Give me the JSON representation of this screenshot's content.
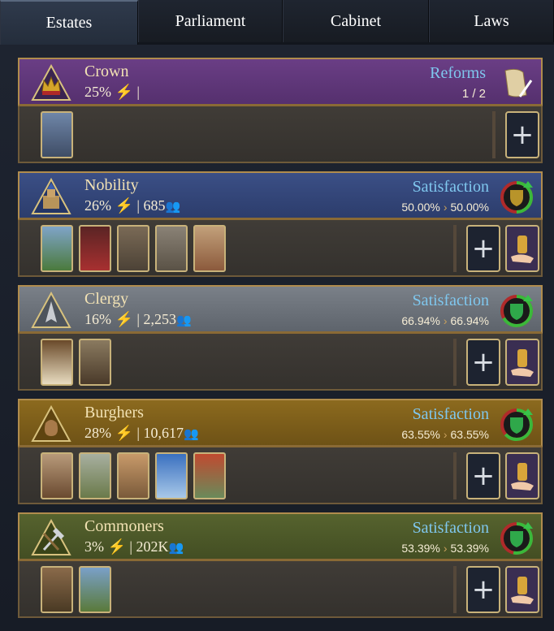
{
  "tabs": [
    "Estates",
    "Parliament",
    "Cabinet",
    "Laws"
  ],
  "estates": [
    {
      "name": "Crown",
      "share": "25%",
      "pop": "",
      "right_label": "Reforms",
      "right_value": "1 / 2",
      "slots": [
        "king-portrait-card"
      ]
    },
    {
      "name": "Nobility",
      "share": "26%",
      "pop": "685",
      "right_label": "Satisfaction",
      "sat_from": "50.00%",
      "sat_to": "50.00%",
      "satisfaction": 0.5,
      "slots": [
        "countryside-card",
        "noble-lady-card",
        "castle-card",
        "noble-couple-card",
        "scroll-card"
      ]
    },
    {
      "name": "Clergy",
      "share": "16%",
      "pop": "2,253",
      "right_label": "Satisfaction",
      "sat_from": "66.94%",
      "sat_to": "66.94%",
      "satisfaction": 0.6694,
      "slots": [
        "bible-card",
        "monk-card"
      ]
    },
    {
      "name": "Burghers",
      "share": "28%",
      "pop": "10,617",
      "right_label": "Satisfaction",
      "sat_from": "63.55%",
      "sat_to": "63.55%",
      "satisfaction": 0.6355,
      "slots": [
        "bear-card",
        "village-card",
        "market-card",
        "lighthouse-card",
        "temple-card"
      ]
    },
    {
      "name": "Commoners",
      "share": "3%",
      "pop": "202K",
      "right_label": "Satisfaction",
      "sat_from": "53.39%",
      "sat_to": "53.39%",
      "satisfaction": 0.5339,
      "slots": [
        "armadillo-card",
        "cow-card"
      ]
    }
  ],
  "colors": {
    "satisfaction_text": "#7fc7ee",
    "bolt": "#f3c623",
    "frame_gold": "#c8b27a"
  }
}
